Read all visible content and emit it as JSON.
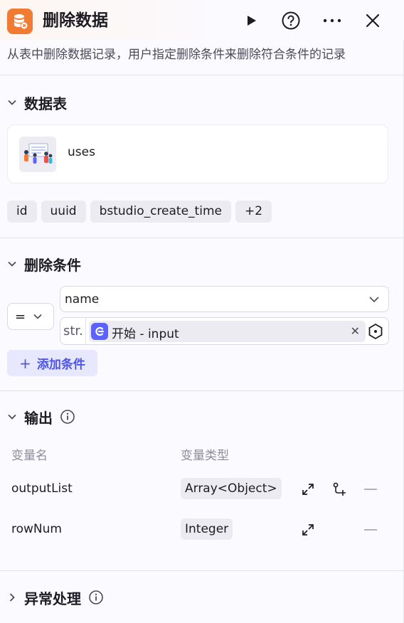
{
  "header": {
    "title": "删除数据",
    "description": "从表中删除数据记录，用户指定删除条件来删除符合条件的记录"
  },
  "table_section": {
    "title": "数据表",
    "table_name": "uses",
    "fields": [
      "id",
      "uuid",
      "bstudio_create_time",
      "+2"
    ]
  },
  "condition_section": {
    "title": "删除条件",
    "operator": "=",
    "field": "name",
    "value_type": "str.",
    "value_ref": "开始 - input",
    "add_label": "添加条件"
  },
  "output_section": {
    "title": "输出",
    "col_name": "变量名",
    "col_type": "变量类型",
    "rows": [
      {
        "name": "outputList",
        "type": "Array<Object>"
      },
      {
        "name": "rowNum",
        "type": "Integer"
      }
    ]
  },
  "exception_section": {
    "title": "异常处理"
  },
  "colors": {
    "node_icon": "#f27b33",
    "accent": "#4d53e8",
    "ref_icon": "#5c62ff"
  }
}
